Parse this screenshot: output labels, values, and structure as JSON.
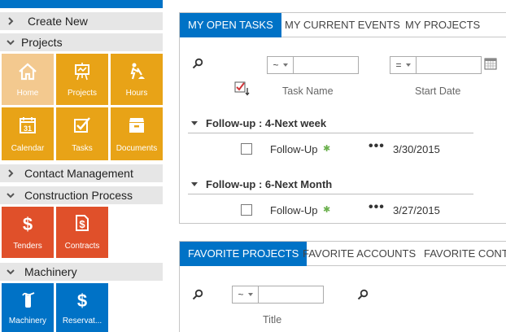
{
  "nav": {
    "create_new": "Create New",
    "projects": {
      "label": "Projects",
      "tiles": [
        "Home",
        "Projects",
        "Hours",
        "Calendar",
        "Tasks",
        "Documents"
      ]
    },
    "contact_management": "Contact Management",
    "construction_process": {
      "label": "Construction Process",
      "tiles": [
        "Tenders",
        "Contracts"
      ]
    },
    "machinery": {
      "label": "Machinery",
      "tiles": [
        "Machinery",
        "Reservat..."
      ]
    },
    "calendar_day": "31"
  },
  "colors": {
    "accent": "#0072c6",
    "tile_orange": "#e8a317",
    "tile_orange_light": "#f3c98f",
    "tile_red": "#e0502a",
    "tile_blue": "#0072c6"
  },
  "tasks_panel": {
    "tabs": [
      "MY OPEN TASKS",
      "MY CURRENT EVENTS",
      "MY PROJECTS"
    ],
    "active_tab": "MY OPEN TASKS",
    "filters": {
      "task_name_op": "~",
      "start_date_op": "="
    },
    "columns": {
      "task_name": "Task Name",
      "start_date": "Start Date"
    },
    "groups": [
      {
        "title": "Follow-up : 4-Next week",
        "rows": [
          {
            "title": "Follow-Up",
            "date": "3/30/2015"
          }
        ]
      },
      {
        "title": "Follow-up : 6-Next Month",
        "rows": [
          {
            "title": "Follow-Up",
            "date": "3/27/2015"
          }
        ]
      }
    ],
    "row_menu": "•••",
    "new_marker": "✱"
  },
  "favorites_panel": {
    "tabs": [
      "FAVORITE PROJECTS",
      "FAVORITE ACCOUNTS",
      "FAVORITE CONTA"
    ],
    "active_tab": "FAVORITE PROJECTS",
    "filters": {
      "title_op": "~"
    },
    "columns": {
      "title": "Title"
    }
  }
}
